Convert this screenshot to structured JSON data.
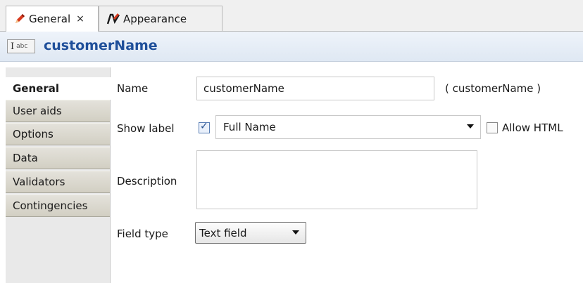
{
  "tabs": [
    {
      "label": "General",
      "icon": "pencil-icon",
      "active": true,
      "close": "×"
    },
    {
      "label": "Appearance",
      "icon": "paint-icon",
      "active": false
    }
  ],
  "title": {
    "icon_text": "abc",
    "icon_cursor": "I",
    "text": "customerName"
  },
  "sidebar": {
    "items": [
      {
        "label": "General",
        "active": true
      },
      {
        "label": "User aids"
      },
      {
        "label": "Options"
      },
      {
        "label": "Data"
      },
      {
        "label": "Validators"
      },
      {
        "label": "Contingencies"
      }
    ]
  },
  "form": {
    "name_label": "Name",
    "name_value": "customerName",
    "name_paren": "( customerName )",
    "show_label_label": "Show label",
    "show_label_checked": true,
    "show_label_value": "Full Name",
    "allow_html_label": "Allow HTML",
    "allow_html_checked": false,
    "description_label": "Description",
    "description_value": "",
    "field_type_label": "Field type",
    "field_type_value": "Text field"
  },
  "colors": {
    "title": "#1f4f9a",
    "accent": "#5a7fb5"
  }
}
